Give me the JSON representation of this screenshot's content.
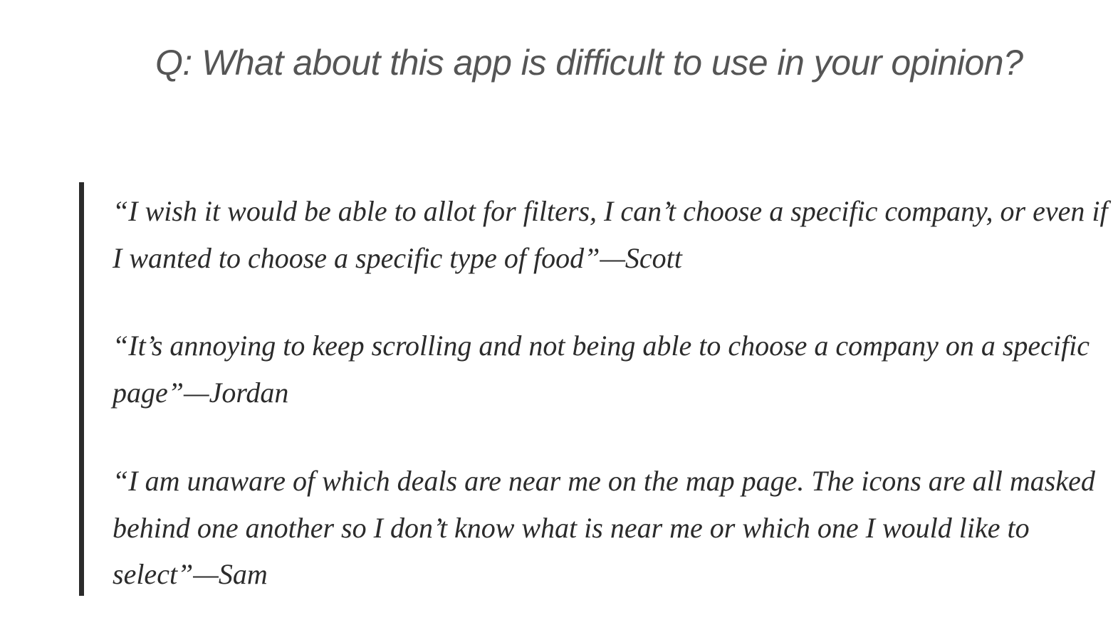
{
  "question": "Q: What about this app is difficult to use in your opinion?",
  "quotes": [
    {
      "text": "“I wish it would be able to allot for filters, I can’t choose a specific company, or even if I wanted to choose a specific type of food”—Scott"
    },
    {
      "text": "“It’s annoying to keep scrolling and not being able to choose a company on a specific page”—Jordan"
    },
    {
      "text": "“I am unaware of which deals are near me on the map page. The icons are all masked behind one another so I don’t know what is near me or which one I would like to select”—Sam"
    }
  ]
}
